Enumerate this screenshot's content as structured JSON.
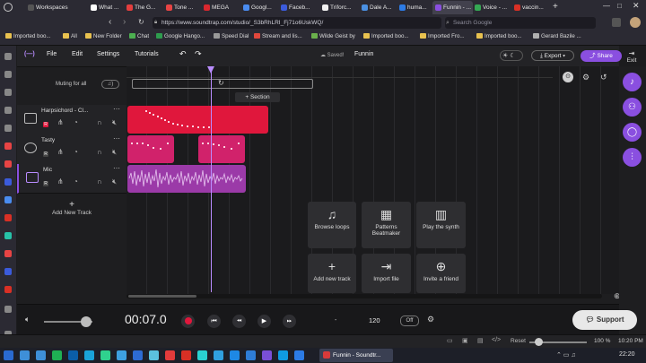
{
  "browser": {
    "tabs": [
      {
        "label": "Workspaces",
        "color": "#3a3a45"
      },
      {
        "label": "What ...",
        "color": "#ffffff"
      },
      {
        "label": "The G...",
        "color": "#e33e3e"
      },
      {
        "label": "Tone ...",
        "color": "#e84444"
      },
      {
        "label": "MEGA",
        "color": "#d9272e"
      },
      {
        "label": "Googl...",
        "color": "#4a8cf0"
      },
      {
        "label": "Faceb...",
        "color": "#3b5bdb"
      },
      {
        "label": "Triforc...",
        "color": "#f0f0f0"
      },
      {
        "label": "Dale A...",
        "color": "#4a90e2"
      },
      {
        "label": "huma...",
        "color": "#2c7be5"
      },
      {
        "label": "Funnin - ...",
        "color": "#8a4fe0"
      },
      {
        "label": "Voice - ...",
        "color": "#34a853"
      },
      {
        "label": "vaccin...",
        "color": "#d93025"
      }
    ],
    "url": "https://www.soundtrap.com/studio/_S3bRhLRI_Fj71o6UskWQ/",
    "search_placeholder": "Search Google",
    "bookmarks": [
      "Imported boo...",
      "All",
      "New Folder",
      "Chat",
      "Google Hango...",
      "Speed Dial",
      "Stream and lis...",
      "Wilde Geist by",
      "Imported boo...",
      "Imported Fro...",
      "Imported boo...",
      "Gerard Bazile ..."
    ]
  },
  "app": {
    "logo": "(—)",
    "menu": [
      "File",
      "Edit",
      "Settings",
      "Tutorials"
    ],
    "saved_label": "Saved!",
    "project_name": "Funnin",
    "export_label": "Export",
    "share_label": "Share",
    "exit_label": "Exit",
    "muting_label": "Muting for all",
    "section_label": "+ Section",
    "tracks": [
      {
        "name": "Harpsichord - Cl...",
        "color": "#e0173c",
        "rec_letter": "R"
      },
      {
        "name": "Tasty",
        "color": "#d1226b",
        "rec_letter": "R"
      },
      {
        "name": "Mic",
        "color": "#9b3aa8",
        "rec_letter": "R"
      }
    ],
    "add_track_label": "Add New Track",
    "cards": [
      {
        "icon": "♫",
        "label": "Browse loops"
      },
      {
        "icon": "▦",
        "label": "Patterns Beatmaker"
      },
      {
        "icon": "▥",
        "label": "Play the synth"
      },
      {
        "icon": "+",
        "label": "Add new track"
      },
      {
        "icon": "⇥",
        "label": "Import file"
      },
      {
        "icon": "⊕",
        "label": "Invite a friend"
      }
    ],
    "transport": {
      "time": "00:07.0",
      "key": "-",
      "tempo": "120",
      "metronome": "Off",
      "support_label": "Support"
    },
    "status": {
      "reset_label": "Reset",
      "zoom": "100 %",
      "clock": "10:20 PM"
    },
    "taskbar": {
      "active_window": "Funnin - Soundtr...",
      "time": "22:20"
    },
    "colors": {
      "accent": "#8a4fe0",
      "harpsichord": "#e0173c",
      "tasty": "#d1226b",
      "mic": "#9b3aa8"
    }
  }
}
